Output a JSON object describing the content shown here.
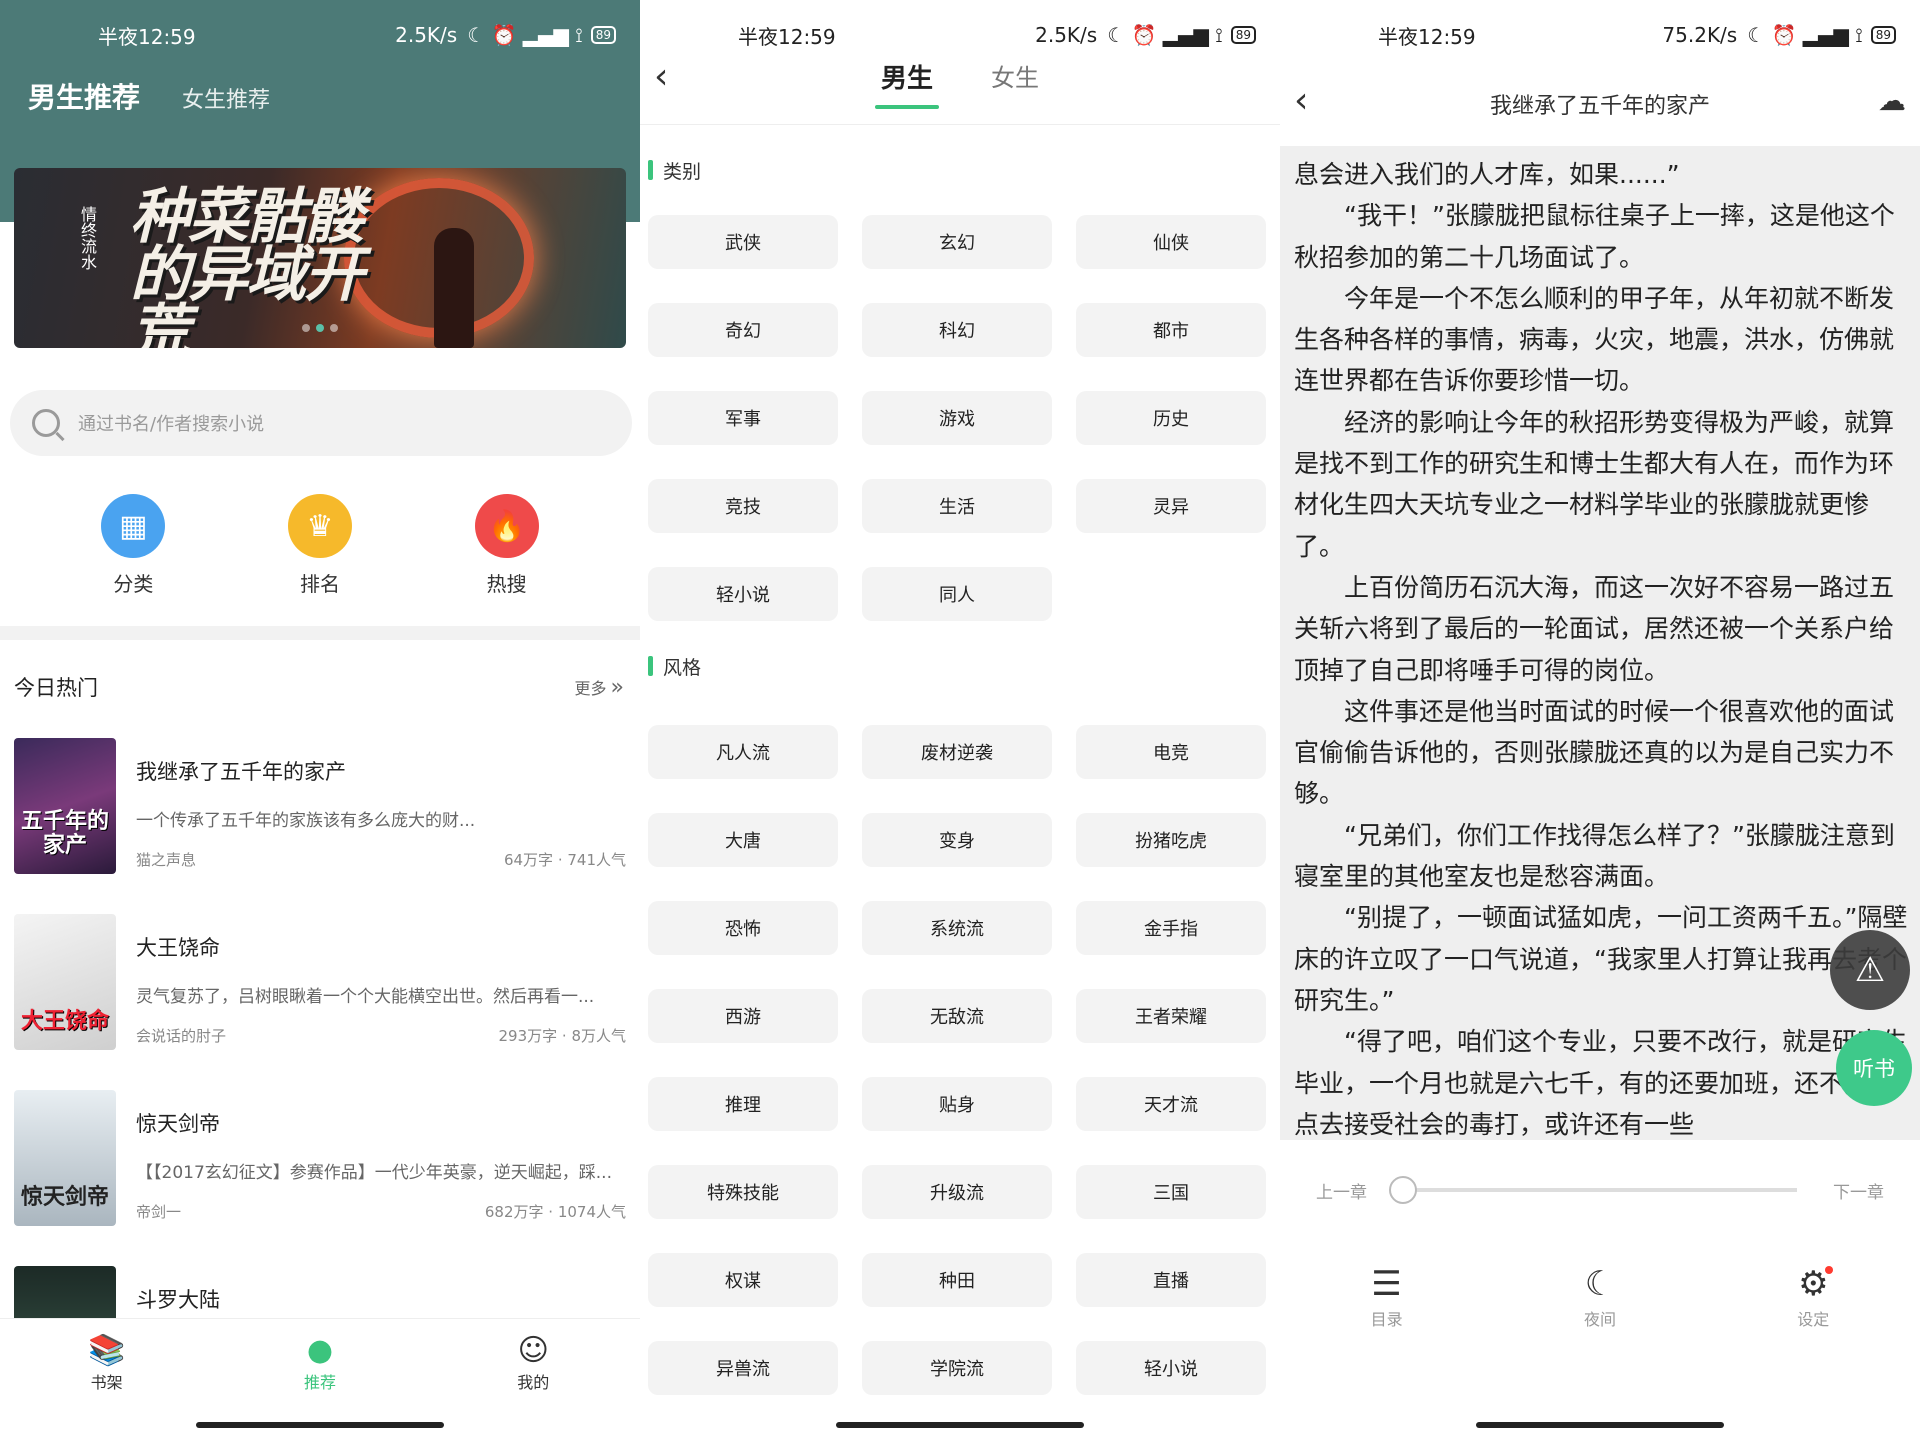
{
  "status": {
    "left": {
      "time": "半夜12:59",
      "speed": "2.5K/s",
      "battery": "89"
    },
    "middle": {
      "time": "半夜12:59",
      "speed": "2.5K/s",
      "battery": "89"
    },
    "right": {
      "time": "半夜12:59",
      "speed": "75.2K/s",
      "battery": "89"
    },
    "icons": "☾ ⏰ ▂▄▆ ⟟"
  },
  "home": {
    "tabs": [
      "男生推荐",
      "女生推荐"
    ],
    "banner": {
      "title": "种菜骷髅的异域开荒",
      "vertical": "情终流水"
    },
    "search_placeholder": "通过书名/作者搜索小说",
    "quick": [
      {
        "label": "分类",
        "icon": "grid-icon",
        "color": "#4aa3f0"
      },
      {
        "label": "排名",
        "icon": "crown-icon",
        "color": "#f6b92b"
      },
      {
        "label": "热搜",
        "icon": "flame-icon",
        "color": "#ef4a4a"
      }
    ],
    "section_title": "今日热门",
    "more_label": "更多",
    "books": [
      {
        "title": "我继承了五千年的家产",
        "desc": "一个传承了五千年的家族该有多么庞大的财...",
        "author": "猫之声息",
        "meta": "64万字 · 741人气",
        "cover_text": "五千年的家产",
        "cover_color": "#5a3a7a"
      },
      {
        "title": "大王饶命",
        "desc": "灵气复苏了，吕树眼瞅着一个个大能横空出世。然后再看一...",
        "author": "会说话的肘子",
        "meta": "293万字 · 8万人气",
        "cover_text": "大王饶命",
        "cover_color": "#d9d9d9"
      },
      {
        "title": "惊天剑帝",
        "desc": "【【2017玄幻征文】参赛作品】一代少年英豪，逆天崛起，踩...",
        "author": "帝剑一",
        "meta": "682万字 · 1074人气",
        "cover_text": "惊天剑帝",
        "cover_color": "#cfd6db"
      },
      {
        "title": "斗罗大陆",
        "desc": "",
        "author": "",
        "meta": "",
        "cover_text": "",
        "cover_color": "#2f4a3f"
      }
    ],
    "tabbar": [
      {
        "label": "书架",
        "icon": "bookshelf-icon",
        "active": false
      },
      {
        "label": "推荐",
        "icon": "leaf-icon",
        "active": true
      },
      {
        "label": "我的",
        "icon": "user-icon",
        "active": false
      }
    ]
  },
  "category": {
    "tabs": [
      "男生",
      "女生"
    ],
    "groups": [
      {
        "title": "类别",
        "items": [
          "武侠",
          "玄幻",
          "仙侠",
          "奇幻",
          "科幻",
          "都市",
          "军事",
          "游戏",
          "历史",
          "竞技",
          "生活",
          "灵异",
          "轻小说",
          "同人"
        ]
      },
      {
        "title": "风格",
        "items": [
          "凡人流",
          "废材逆袭",
          "电竞",
          "大唐",
          "变身",
          "扮猪吃虎",
          "恐怖",
          "系统流",
          "金手指",
          "西游",
          "无敌流",
          "王者荣耀",
          "推理",
          "贴身",
          "天才流",
          "特殊技能",
          "升级流",
          "三国",
          "权谋",
          "种田",
          "直播",
          "异兽流",
          "学院流",
          "轻小说"
        ]
      }
    ]
  },
  "reader": {
    "title": "我继承了五千年的家产",
    "paragraphs": [
      {
        "text": "息会进入我们的人才库，如果......”",
        "indent": false
      },
      {
        "text": "“我干！”张朦胧把鼠标往桌子上一摔，这是他这个秋招参加的第二十几场面试了。",
        "indent": true
      },
      {
        "text": "今年是一个不怎么顺利的甲子年，从年初就不断发生各种各样的事情，病毒，火灾，地震，洪水，仿佛就连世界都在告诉你要珍惜一切。",
        "indent": true
      },
      {
        "text": "经济的影响让今年的秋招形势变得极为严峻，就算是找不到工作的研究生和博士生都大有人在，而作为环材化生四大天坑专业之一材料学毕业的张朦胧就更惨了。",
        "indent": true
      },
      {
        "text": "上百份简历石沉大海，而这一次好不容易一路过五关斩六将到了最后的一轮面试，居然还被一个关系户给顶掉了自己即将唾手可得的岗位。",
        "indent": true
      },
      {
        "text": "这件事还是他当时面试的时候一个很喜欢他的面试官偷偷告诉他的，否则张朦胧还真的以为是自己实力不够。",
        "indent": true
      },
      {
        "text": "“兄弟们，你们工作找得怎么样了？”张朦胧注意到寝室里的其他室友也是愁容满面。",
        "indent": true
      },
      {
        "text": "“别提了，一顿面试猛如虎，一问工资两千五。”隔壁床的许立叹了一口气说道，“我家里人打算让我再去考个研究生。”",
        "indent": true
      },
      {
        "text": "“得了吧，咱们这个专业，只要不改行，就是研究生毕业，一个月也就是六七千，有的还要加班，还不如早点去接受社会的毒打，或许还有一些",
        "indent": true
      }
    ],
    "listen_label": "听书",
    "prev_label": "上一章",
    "next_label": "下一章",
    "progress": 0,
    "menu": [
      {
        "label": "目录",
        "icon": "list-icon"
      },
      {
        "label": "夜间",
        "icon": "moon-icon"
      },
      {
        "label": "设定",
        "icon": "settings-icon"
      }
    ]
  }
}
